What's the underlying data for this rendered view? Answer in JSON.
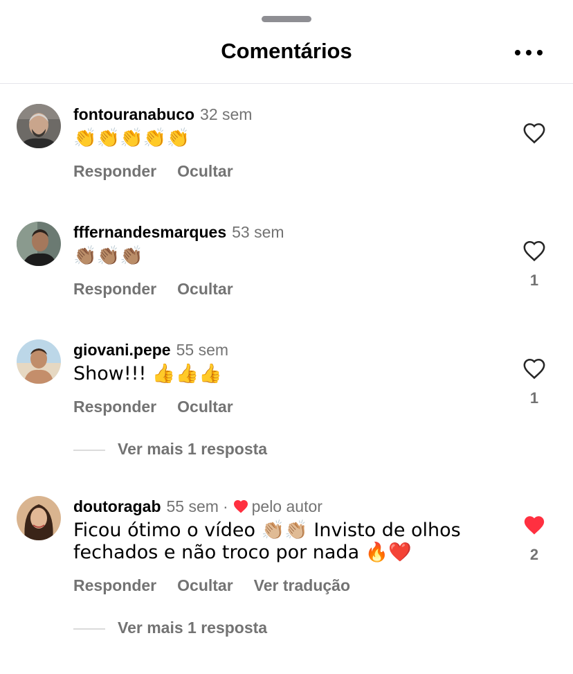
{
  "header": {
    "title": "Comentários",
    "more_icon": "more-horizontal-icon"
  },
  "comments": [
    {
      "username": "fontouranabuco",
      "time": "32 sem",
      "text": "👏👏👏👏👏",
      "actions": [
        "Responder",
        "Ocultar"
      ],
      "liked": false,
      "like_count": ""
    },
    {
      "username": "fffernandesmarques",
      "time": "53 sem",
      "text": "👏🏽👏🏽👏🏽",
      "actions": [
        "Responder",
        "Ocultar"
      ],
      "liked": false,
      "like_count": "1"
    },
    {
      "username": "giovani.pepe",
      "time": "55 sem",
      "text": "Show!!! 👍👍👍",
      "actions": [
        "Responder",
        "Ocultar"
      ],
      "liked": false,
      "like_count": "1",
      "view_more": "Ver mais 1 resposta"
    },
    {
      "username": "doutoragab",
      "time": "55 sem",
      "separator": "·",
      "author_badge": "pelo autor",
      "text_line1": "Ficou ótimo o vídeo 👏🏼👏🏼 Invisto de olhos",
      "text_line2": "fechados e não troco por nada 🔥❤️",
      "actions": [
        "Responder",
        "Ocultar",
        "Ver tradução"
      ],
      "liked": true,
      "like_count": "2",
      "view_more": "Ver mais 1 resposta"
    }
  ],
  "colors": {
    "secondary_text": "#737373",
    "like_red": "#ff3040",
    "divider": "#e5e5ea"
  }
}
